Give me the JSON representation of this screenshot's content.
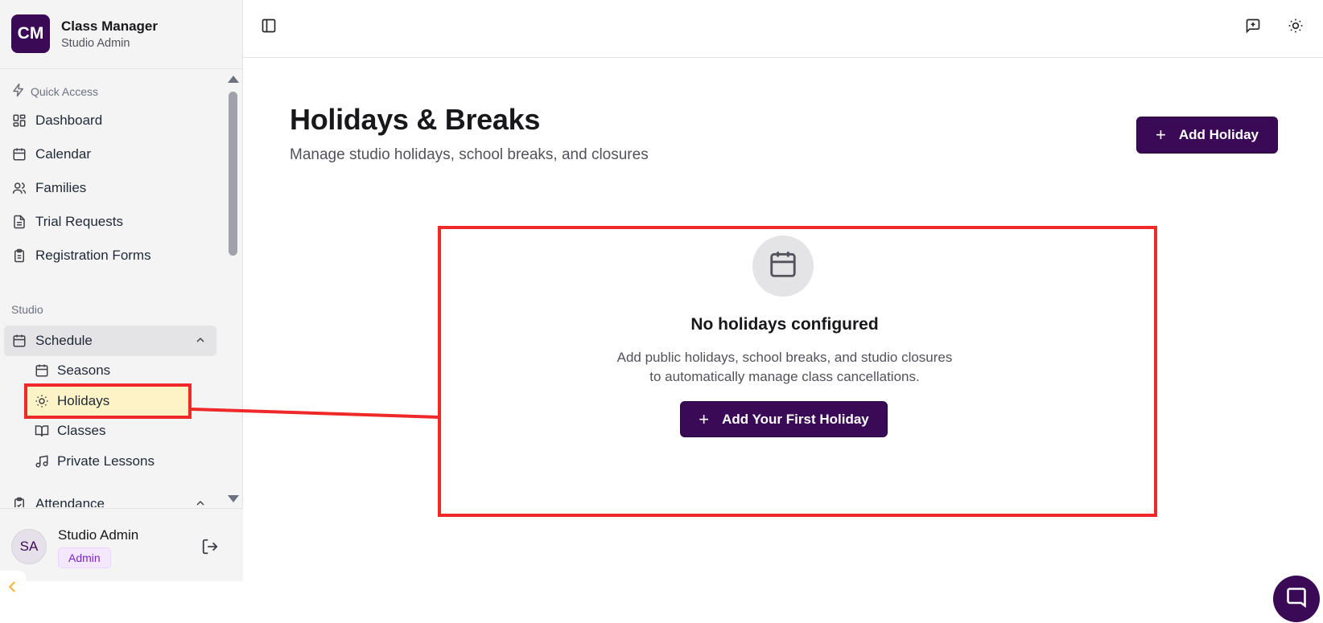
{
  "brand": {
    "logo": "CM",
    "title": "Class Manager",
    "subtitle": "Studio Admin"
  },
  "sidebar": {
    "quick_access_label": "Quick Access",
    "quick_items": [
      {
        "label": "Dashboard",
        "icon": "dashboard-icon"
      },
      {
        "label": "Calendar",
        "icon": "calendar-icon"
      },
      {
        "label": "Families",
        "icon": "users-icon"
      },
      {
        "label": "Trial Requests",
        "icon": "document-icon"
      },
      {
        "label": "Registration Forms",
        "icon": "clipboard-icon"
      }
    ],
    "studio_label": "Studio",
    "schedule": {
      "label": "Schedule",
      "expanded": true,
      "children": [
        {
          "label": "Seasons",
          "icon": "calendar-icon"
        },
        {
          "label": "Holidays",
          "icon": "sun-icon",
          "current": true
        },
        {
          "label": "Classes",
          "icon": "book-icon"
        },
        {
          "label": "Private Lessons",
          "icon": "music-note-icon"
        }
      ]
    },
    "attendance": {
      "label": "Attendance",
      "expanded": true
    }
  },
  "user": {
    "initials": "SA",
    "name": "Studio Admin",
    "role": "Admin"
  },
  "topbar": {
    "toggle_icon": "sidebar-toggle-icon",
    "feedback_icon": "message-plus-icon",
    "theme_icon": "sun-icon"
  },
  "page": {
    "title": "Holidays & Breaks",
    "subtitle": "Manage studio holidays, school breaks, and closures",
    "add_button": "Add Holiday"
  },
  "empty_state": {
    "title": "No holidays configured",
    "description_line1": "Add public holidays, school breaks, and studio closures",
    "description_line2": "to automatically manage class cancellations.",
    "button": "Add Your First Holiday"
  },
  "colors": {
    "brand": "#3b0a57",
    "highlight": "#ef2929",
    "current_item_bg": "#fef3c7"
  }
}
